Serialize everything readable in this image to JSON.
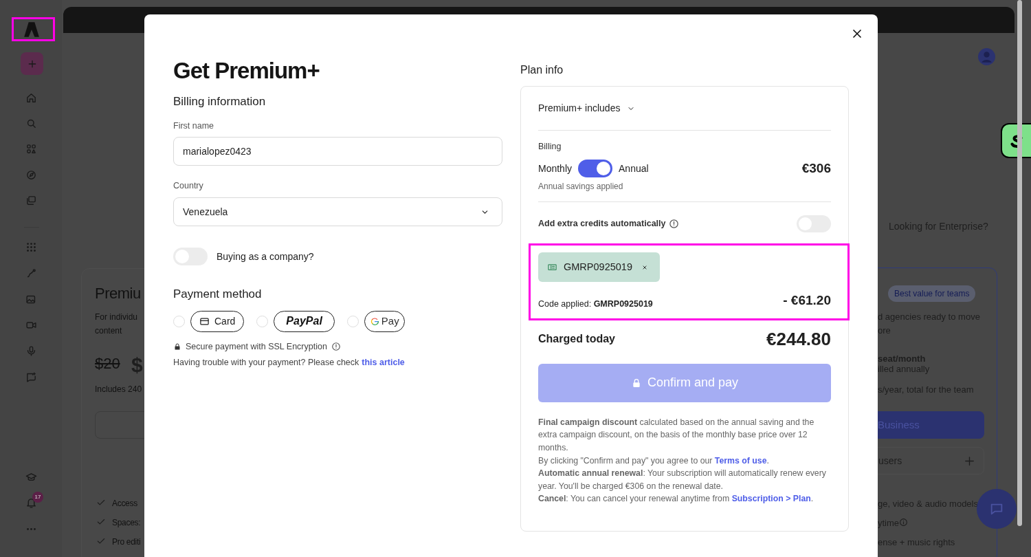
{
  "sidebar": {
    "notification_badge": "17"
  },
  "background_page": {
    "left_plan": {
      "title": "Premiu",
      "description_lines": [
        "For individu",
        "content"
      ],
      "old_price": "$20",
      "price": "$",
      "includes": "Includes 240",
      "features": [
        "Access",
        "Spaces:",
        "Pro editi"
      ]
    },
    "enterprise_link": "Looking for Enterprise?",
    "right_plan": {
      "badge": "Best value for teams",
      "description_lines": [
        "d agencies ready to move",
        "ore"
      ],
      "price_unit": "seat/month",
      "billing_note": "illed annually",
      "credits_note": "s/year, total for the team",
      "button": "Business",
      "users_field": "users",
      "features": [
        "ge, video & audio models",
        "ytime",
        "ense + music rights"
      ]
    }
  },
  "modal": {
    "title": "Get Premium+",
    "billing": {
      "heading": "Billing information",
      "fields": [
        {
          "kind": "text",
          "label": "First name",
          "value": "marialopez0423"
        },
        {
          "kind": "select",
          "label": "Country",
          "value": "Venezuela"
        }
      ],
      "company_toggle": {
        "label": "Buying as a company?",
        "on": false
      }
    },
    "payment": {
      "heading": "Payment method",
      "methods": [
        {
          "kind": "card",
          "label": "Card",
          "selected": false
        },
        {
          "kind": "paypal",
          "label": "PayPal",
          "selected": false
        },
        {
          "kind": "gpay",
          "label": "Pay",
          "selected": false
        }
      ],
      "secure_note": "Secure payment with SSL Encryption",
      "help_text": "Having trouble with your payment? Please check",
      "help_link": "this article"
    },
    "plan_info": {
      "heading": "Plan info",
      "includes_label": "Premium+ includes",
      "expanded": false,
      "billing_label": "Billing",
      "period_left": "Monthly",
      "period_right": "Annual",
      "annual": true,
      "price": "€306",
      "savings_note": "Annual savings applied",
      "extra_credits": {
        "label": "Add extra credits automatically",
        "on": false
      },
      "coupon": {
        "code": "GMRP0925019",
        "applied_label": "Code applied:",
        "applied_code": "GMRP0925019",
        "discount": "- €61.20"
      },
      "charged_label": "Charged today",
      "total": "€244.80",
      "confirm_button": {
        "label": "Confirm and pay",
        "disabled": true
      },
      "legal": [
        {
          "text": "**Final campaign discount** calculated based on the annual saving and the extra campaign discount, on the basis of the monthly base price over 12 months."
        },
        {
          "text": "By clicking \"Confirm and pay\" you agree to our ",
          "link": "Terms of use",
          "after": "."
        },
        {
          "text": "**Automatic annual renewal**: Your subscription will automatically renew every year. You'll be charged €306 on the renewal date."
        },
        {
          "text": "**Cancel**: You can cancel your renewal anytime from ",
          "link": "Subscription > Plan",
          "after": "."
        }
      ]
    }
  }
}
